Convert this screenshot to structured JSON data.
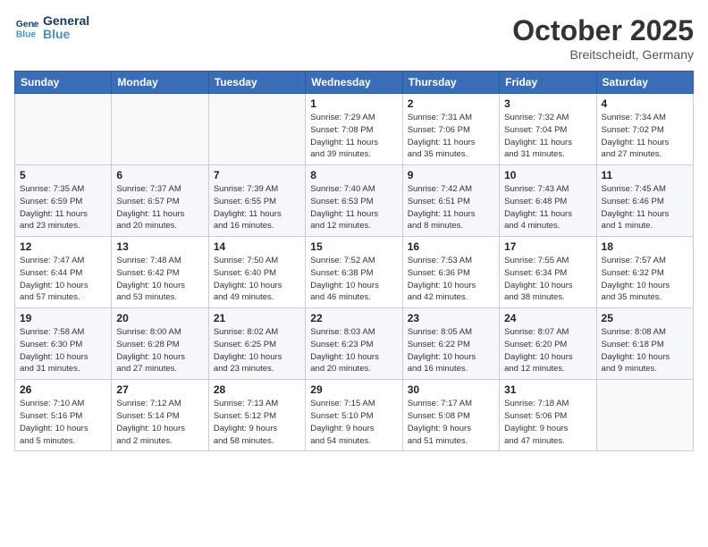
{
  "header": {
    "logo_line1": "General",
    "logo_line2": "Blue",
    "month": "October 2025",
    "location": "Breitscheidt, Germany"
  },
  "weekdays": [
    "Sunday",
    "Monday",
    "Tuesday",
    "Wednesday",
    "Thursday",
    "Friday",
    "Saturday"
  ],
  "weeks": [
    [
      {
        "day": "",
        "info": ""
      },
      {
        "day": "",
        "info": ""
      },
      {
        "day": "",
        "info": ""
      },
      {
        "day": "1",
        "info": "Sunrise: 7:29 AM\nSunset: 7:08 PM\nDaylight: 11 hours\nand 39 minutes."
      },
      {
        "day": "2",
        "info": "Sunrise: 7:31 AM\nSunset: 7:06 PM\nDaylight: 11 hours\nand 35 minutes."
      },
      {
        "day": "3",
        "info": "Sunrise: 7:32 AM\nSunset: 7:04 PM\nDaylight: 11 hours\nand 31 minutes."
      },
      {
        "day": "4",
        "info": "Sunrise: 7:34 AM\nSunset: 7:02 PM\nDaylight: 11 hours\nand 27 minutes."
      }
    ],
    [
      {
        "day": "5",
        "info": "Sunrise: 7:35 AM\nSunset: 6:59 PM\nDaylight: 11 hours\nand 23 minutes."
      },
      {
        "day": "6",
        "info": "Sunrise: 7:37 AM\nSunset: 6:57 PM\nDaylight: 11 hours\nand 20 minutes."
      },
      {
        "day": "7",
        "info": "Sunrise: 7:39 AM\nSunset: 6:55 PM\nDaylight: 11 hours\nand 16 minutes."
      },
      {
        "day": "8",
        "info": "Sunrise: 7:40 AM\nSunset: 6:53 PM\nDaylight: 11 hours\nand 12 minutes."
      },
      {
        "day": "9",
        "info": "Sunrise: 7:42 AM\nSunset: 6:51 PM\nDaylight: 11 hours\nand 8 minutes."
      },
      {
        "day": "10",
        "info": "Sunrise: 7:43 AM\nSunset: 6:48 PM\nDaylight: 11 hours\nand 4 minutes."
      },
      {
        "day": "11",
        "info": "Sunrise: 7:45 AM\nSunset: 6:46 PM\nDaylight: 11 hours\nand 1 minute."
      }
    ],
    [
      {
        "day": "12",
        "info": "Sunrise: 7:47 AM\nSunset: 6:44 PM\nDaylight: 10 hours\nand 57 minutes."
      },
      {
        "day": "13",
        "info": "Sunrise: 7:48 AM\nSunset: 6:42 PM\nDaylight: 10 hours\nand 53 minutes."
      },
      {
        "day": "14",
        "info": "Sunrise: 7:50 AM\nSunset: 6:40 PM\nDaylight: 10 hours\nand 49 minutes."
      },
      {
        "day": "15",
        "info": "Sunrise: 7:52 AM\nSunset: 6:38 PM\nDaylight: 10 hours\nand 46 minutes."
      },
      {
        "day": "16",
        "info": "Sunrise: 7:53 AM\nSunset: 6:36 PM\nDaylight: 10 hours\nand 42 minutes."
      },
      {
        "day": "17",
        "info": "Sunrise: 7:55 AM\nSunset: 6:34 PM\nDaylight: 10 hours\nand 38 minutes."
      },
      {
        "day": "18",
        "info": "Sunrise: 7:57 AM\nSunset: 6:32 PM\nDaylight: 10 hours\nand 35 minutes."
      }
    ],
    [
      {
        "day": "19",
        "info": "Sunrise: 7:58 AM\nSunset: 6:30 PM\nDaylight: 10 hours\nand 31 minutes."
      },
      {
        "day": "20",
        "info": "Sunrise: 8:00 AM\nSunset: 6:28 PM\nDaylight: 10 hours\nand 27 minutes."
      },
      {
        "day": "21",
        "info": "Sunrise: 8:02 AM\nSunset: 6:25 PM\nDaylight: 10 hours\nand 23 minutes."
      },
      {
        "day": "22",
        "info": "Sunrise: 8:03 AM\nSunset: 6:23 PM\nDaylight: 10 hours\nand 20 minutes."
      },
      {
        "day": "23",
        "info": "Sunrise: 8:05 AM\nSunset: 6:22 PM\nDaylight: 10 hours\nand 16 minutes."
      },
      {
        "day": "24",
        "info": "Sunrise: 8:07 AM\nSunset: 6:20 PM\nDaylight: 10 hours\nand 12 minutes."
      },
      {
        "day": "25",
        "info": "Sunrise: 8:08 AM\nSunset: 6:18 PM\nDaylight: 10 hours\nand 9 minutes."
      }
    ],
    [
      {
        "day": "26",
        "info": "Sunrise: 7:10 AM\nSunset: 5:16 PM\nDaylight: 10 hours\nand 5 minutes."
      },
      {
        "day": "27",
        "info": "Sunrise: 7:12 AM\nSunset: 5:14 PM\nDaylight: 10 hours\nand 2 minutes."
      },
      {
        "day": "28",
        "info": "Sunrise: 7:13 AM\nSunset: 5:12 PM\nDaylight: 9 hours\nand 58 minutes."
      },
      {
        "day": "29",
        "info": "Sunrise: 7:15 AM\nSunset: 5:10 PM\nDaylight: 9 hours\nand 54 minutes."
      },
      {
        "day": "30",
        "info": "Sunrise: 7:17 AM\nSunset: 5:08 PM\nDaylight: 9 hours\nand 51 minutes."
      },
      {
        "day": "31",
        "info": "Sunrise: 7:18 AM\nSunset: 5:06 PM\nDaylight: 9 hours\nand 47 minutes."
      },
      {
        "day": "",
        "info": ""
      }
    ]
  ]
}
